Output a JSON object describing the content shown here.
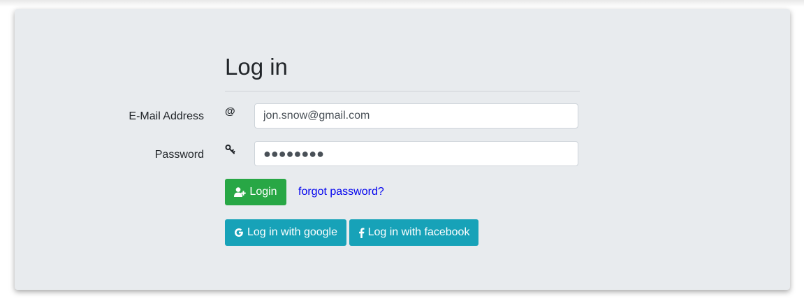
{
  "form": {
    "title": "Log in",
    "email": {
      "label": "E-Mail Address",
      "icon": "at-icon",
      "icon_glyph": "@",
      "value": "jon.snow@gmail.com"
    },
    "password": {
      "label": "Password",
      "icon": "key-icon",
      "value": "●●●●●●●●"
    },
    "login_button": {
      "label": "Login",
      "icon": "user-plus-icon"
    },
    "forgot_link": "forgot password?",
    "google_button": {
      "label": "Log in with google",
      "icon": "google-icon"
    },
    "facebook_button": {
      "label": "Log in with facebook",
      "icon": "facebook-icon"
    }
  },
  "colors": {
    "card_background": "#e8ebee",
    "login_button": "#28a745",
    "social_buttons": "#17a2b8",
    "link": "#0000ee"
  }
}
